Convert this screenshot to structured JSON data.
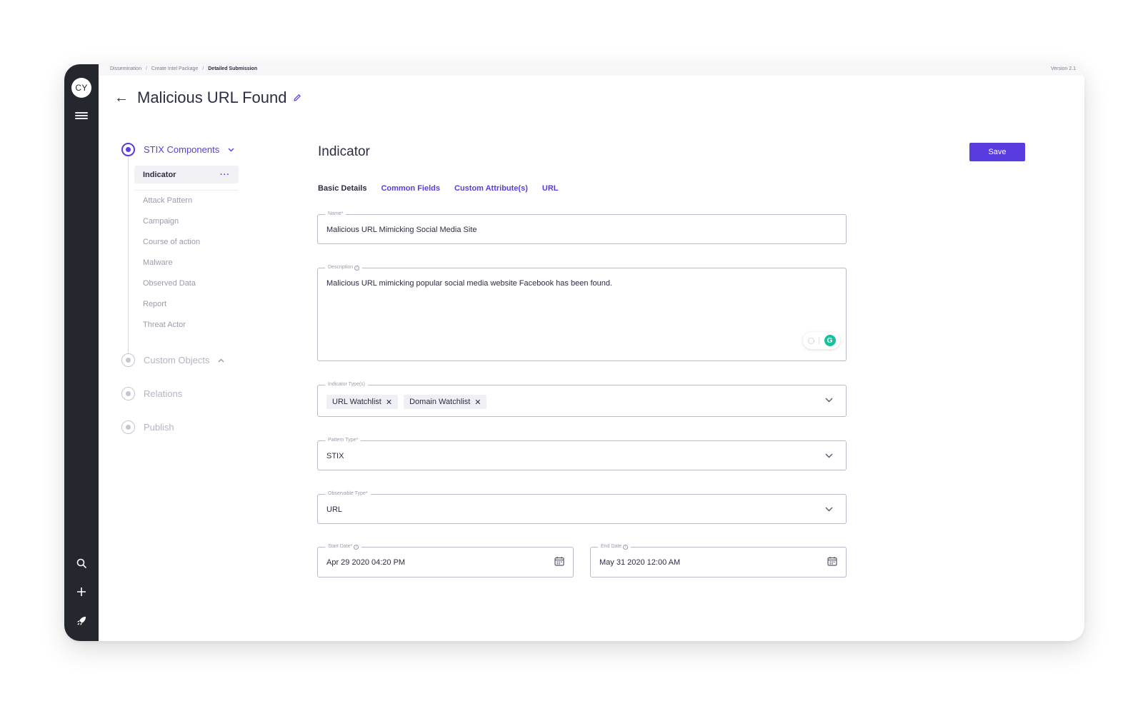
{
  "user": {
    "initials": "CY"
  },
  "breadcrumb": {
    "items": [
      "Dissemination",
      "Create Intel Package"
    ],
    "separator": "/",
    "current": "Detailed Submission"
  },
  "version": "Version 2.1",
  "page": {
    "title": "Malicious URL Found"
  },
  "stepper": {
    "steps": [
      {
        "label": "STIX Components",
        "active": true
      },
      {
        "label": "Custom Objects",
        "active": false
      },
      {
        "label": "Relations",
        "active": false
      },
      {
        "label": "Publish",
        "active": false
      }
    ],
    "components": {
      "active": "Indicator",
      "more": "···",
      "items": [
        "Attack Pattern",
        "Campaign",
        "Course of action",
        "Malware",
        "Observed Data",
        "Report",
        "Threat Actor"
      ]
    }
  },
  "form": {
    "section_title": "Indicator",
    "save_label": "Save",
    "tabs": [
      "Basic Details",
      "Common Fields",
      "Custom Attribute(s)",
      "URL"
    ],
    "name": {
      "label": "Name*",
      "value": "Malicious URL Mimicking Social Media Site"
    },
    "description": {
      "label": "Description",
      "value": "Malicious URL mimicking popular social media website Facebook has been found."
    },
    "indicator_types": {
      "label": "Indicator Type(s)",
      "chips": [
        "URL Watchlist",
        "Domain Watchlist"
      ]
    },
    "pattern_type": {
      "label": "Pattern Type*",
      "value": "STIX"
    },
    "observable_type": {
      "label": "Observable Type*",
      "value": "URL"
    },
    "start_date": {
      "label": "Start Date*",
      "value": "Apr 29 2020 04:20 PM"
    },
    "end_date": {
      "label": "End Date",
      "value": "May 31 2020 12:00 AM"
    }
  },
  "grammarly": {
    "badge": "G"
  },
  "colors": {
    "accent": "#5a3be0",
    "rail": "#25272e",
    "grammarly": "#15c39a"
  }
}
